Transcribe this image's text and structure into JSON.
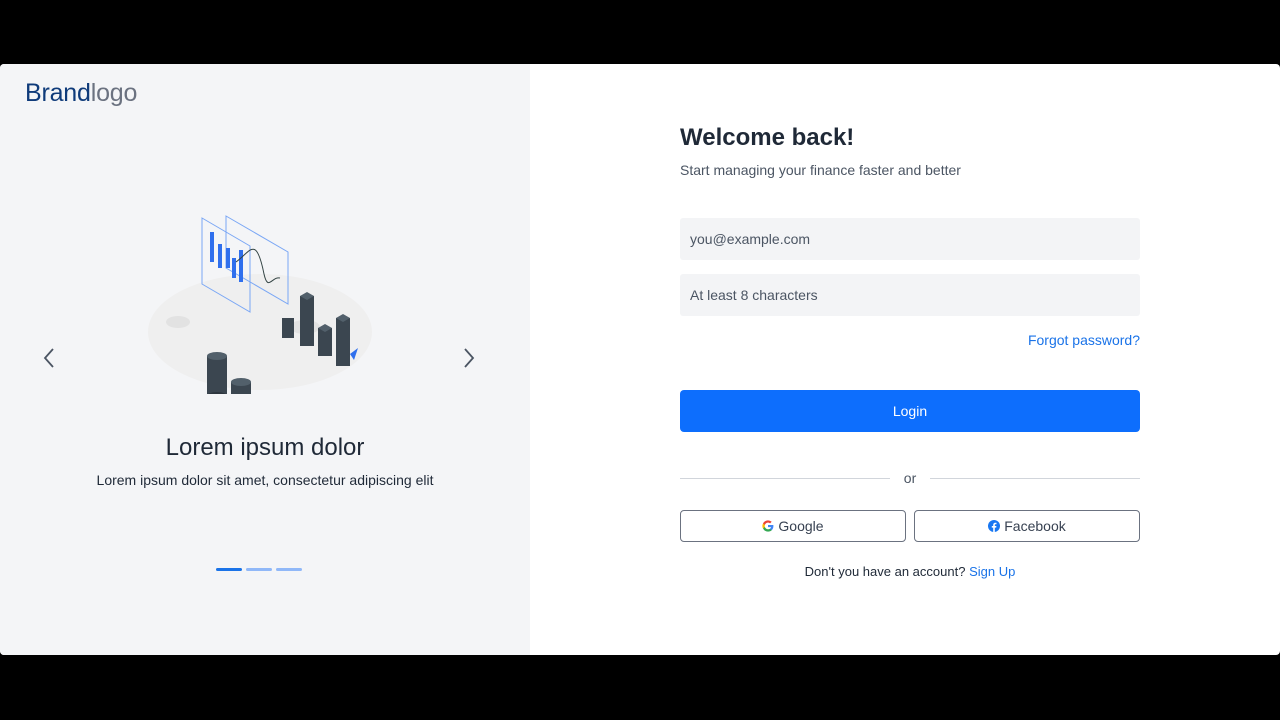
{
  "brand": {
    "part1": "Brand",
    "part2": "logo"
  },
  "carousel": {
    "slide_title": "Lorem ipsum dolor",
    "slide_subtitle": "Lorem ipsum dolor sit amet, consectetur adipiscing elit",
    "prev_icon": "chevron-left-icon",
    "next_icon": "chevron-right-icon",
    "slide_count": 3,
    "active_slide": 1
  },
  "form": {
    "title": "Welcome back!",
    "subtitle": "Start managing your finance faster and better",
    "email_placeholder": "you@example.com",
    "password_placeholder": "At least 8 characters",
    "forgot_label": "Forgot password?",
    "login_label": "Login",
    "divider_label": "or",
    "google_label": "Google",
    "facebook_label": "Facebook",
    "signup_prompt": "Don't you have an account?",
    "signup_label": "Sign Up"
  },
  "colors": {
    "primary": "#0d6efd",
    "link": "#1a73e8",
    "brand_dark": "#0f3b7a",
    "panel_bg": "#f4f5f7"
  }
}
